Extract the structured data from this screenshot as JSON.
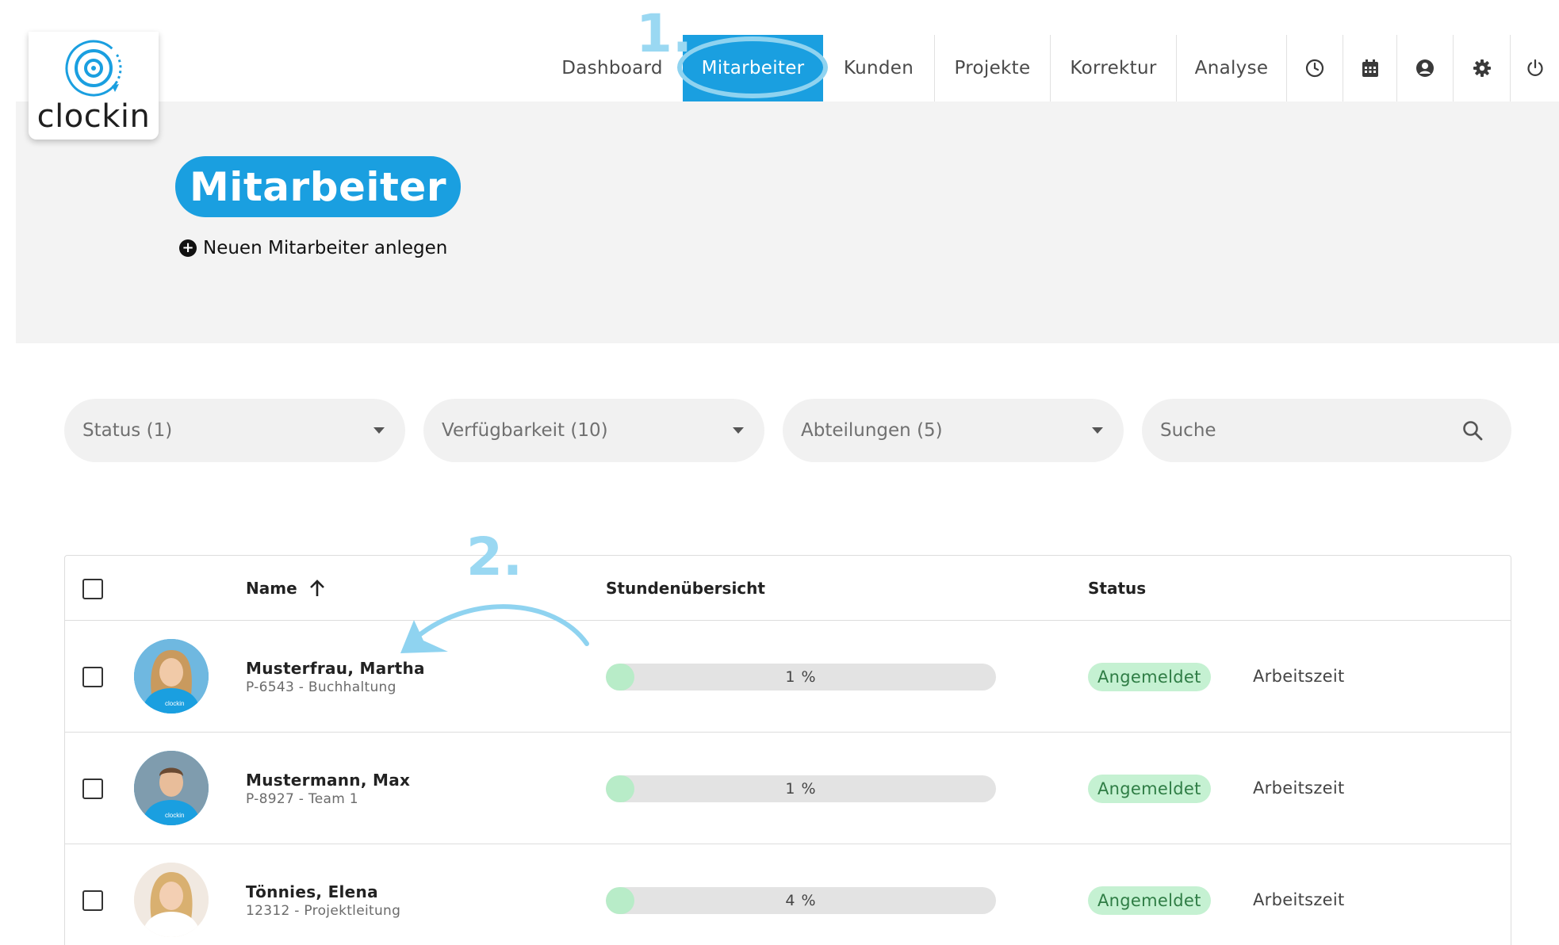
{
  "app": {
    "logo_text": "clockin"
  },
  "nav": {
    "items": [
      {
        "label": "Dashboard",
        "active": false
      },
      {
        "label": "Mitarbeiter",
        "active": true
      },
      {
        "label": "Kunden",
        "active": false
      },
      {
        "label": "Projekte",
        "active": false
      },
      {
        "label": "Korrektur",
        "active": false
      },
      {
        "label": "Analyse",
        "active": false
      }
    ],
    "icons": [
      "clock-icon",
      "calendar-icon",
      "user-circle-icon",
      "gear-icon",
      "power-icon"
    ]
  },
  "annotations": {
    "step1": "1.",
    "step2": "2."
  },
  "page": {
    "title": "Mitarbeiter",
    "new_link": "Neuen Mitarbeiter anlegen"
  },
  "filters": {
    "status": "Status (1)",
    "availability": "Verfügbarkeit (10)",
    "departments": "Abteilungen (5)",
    "search_placeholder": "Suche"
  },
  "table": {
    "headers": {
      "name": "Name",
      "hours": "Stundenübersicht",
      "status": "Status"
    },
    "rows": [
      {
        "name": "Musterfrau, Martha",
        "sub": "P-6543 - Buchhaltung",
        "progress_label": "1 %",
        "progress": 0.01,
        "status": "Angemeldet",
        "mode": "Arbeitszeit"
      },
      {
        "name": "Mustermann, Max",
        "sub": "P-8927 - Team 1",
        "progress_label": "1 %",
        "progress": 0.01,
        "status": "Angemeldet",
        "mode": "Arbeitszeit"
      },
      {
        "name": "Tönnies, Elena",
        "sub": "12312 - Projektleitung",
        "progress_label": "4 %",
        "progress": 0.04,
        "status": "Angemeldet",
        "mode": "Arbeitszeit"
      }
    ]
  },
  "colors": {
    "accent": "#1a9fe0",
    "annotation": "#8fd3f0",
    "status_bg": "#c5f1d2",
    "status_text": "#2f7d45",
    "progress_fill": "#b8ecc8"
  }
}
